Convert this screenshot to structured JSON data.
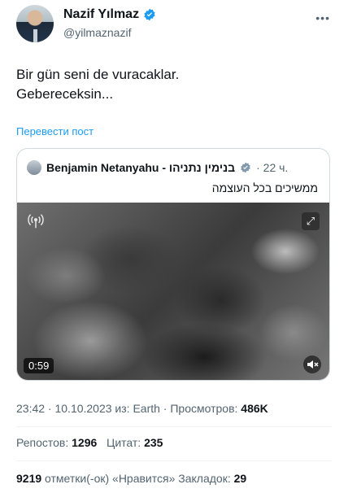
{
  "author": {
    "name": "Nazif Yılmaz",
    "handle": "@yilmaznazif"
  },
  "tweet": {
    "line1": "Bir gün seni de vuracaklar.",
    "line2": "Gebereceksin..."
  },
  "translate_label": "Перевести пост",
  "quote": {
    "name": "Benjamin Netanyahu - בנימין נתניהו",
    "time": "· 22 ч.",
    "text": "ממשיכים בכל העוצמה",
    "video_duration": "0:59"
  },
  "meta": {
    "timestamp": "23:42 · 10.10.2023 из: Earth · Просмотров: ",
    "views": "486K"
  },
  "stats": {
    "reposts_label": "Репостов: ",
    "reposts": "1296",
    "quotes_label": "Цитат: ",
    "quotes": "235",
    "likes": "9219",
    "likes_label": " отметки(-ок) «Нравится» ",
    "bookmarks_label": "Закладок: ",
    "bookmarks": "29"
  },
  "colors": {
    "accent": "#1d9bf0",
    "text": "#0f1419",
    "secondary": "#536471"
  }
}
